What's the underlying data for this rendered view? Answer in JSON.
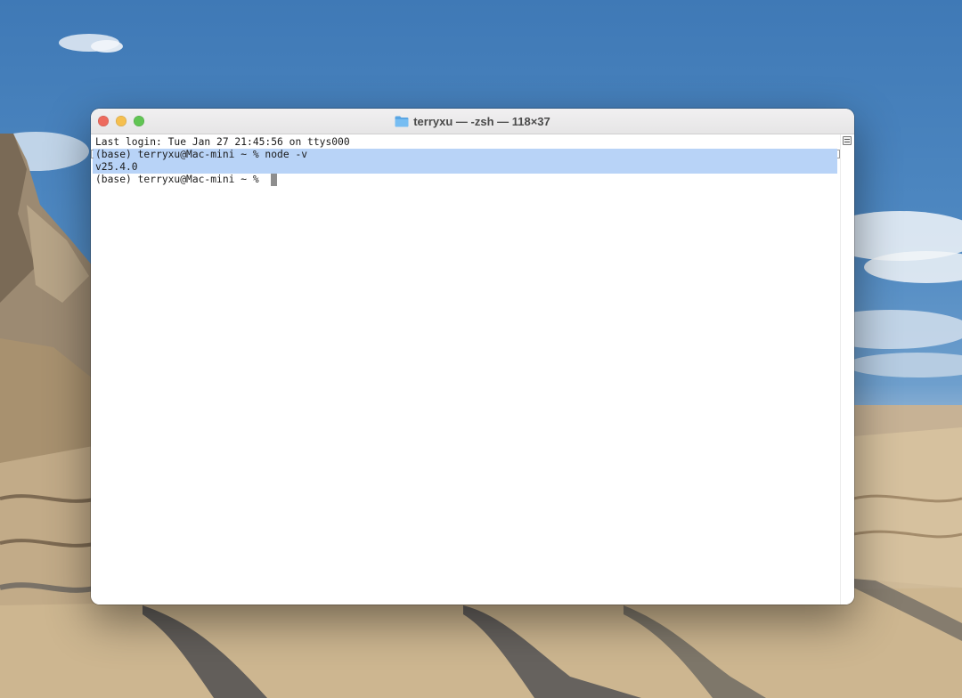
{
  "window": {
    "title": "terryxu — -zsh — 118×37",
    "title_icon": "folder-icon",
    "controls": {
      "close_color": "#ed6a5e",
      "minimize_color": "#f5bf4f",
      "zoom_color": "#61c554"
    }
  },
  "terminal": {
    "lines": [
      "Last login: Tue Jan 27 21:45:56 on ttys000",
      "(base) terryxu@Mac-mini ~ % node -v",
      "v25.4.0",
      "(base) terryxu@Mac-mini ~ % "
    ],
    "selection_color": "#b8d3f7",
    "cursor_color": "#8e8e8e"
  }
}
